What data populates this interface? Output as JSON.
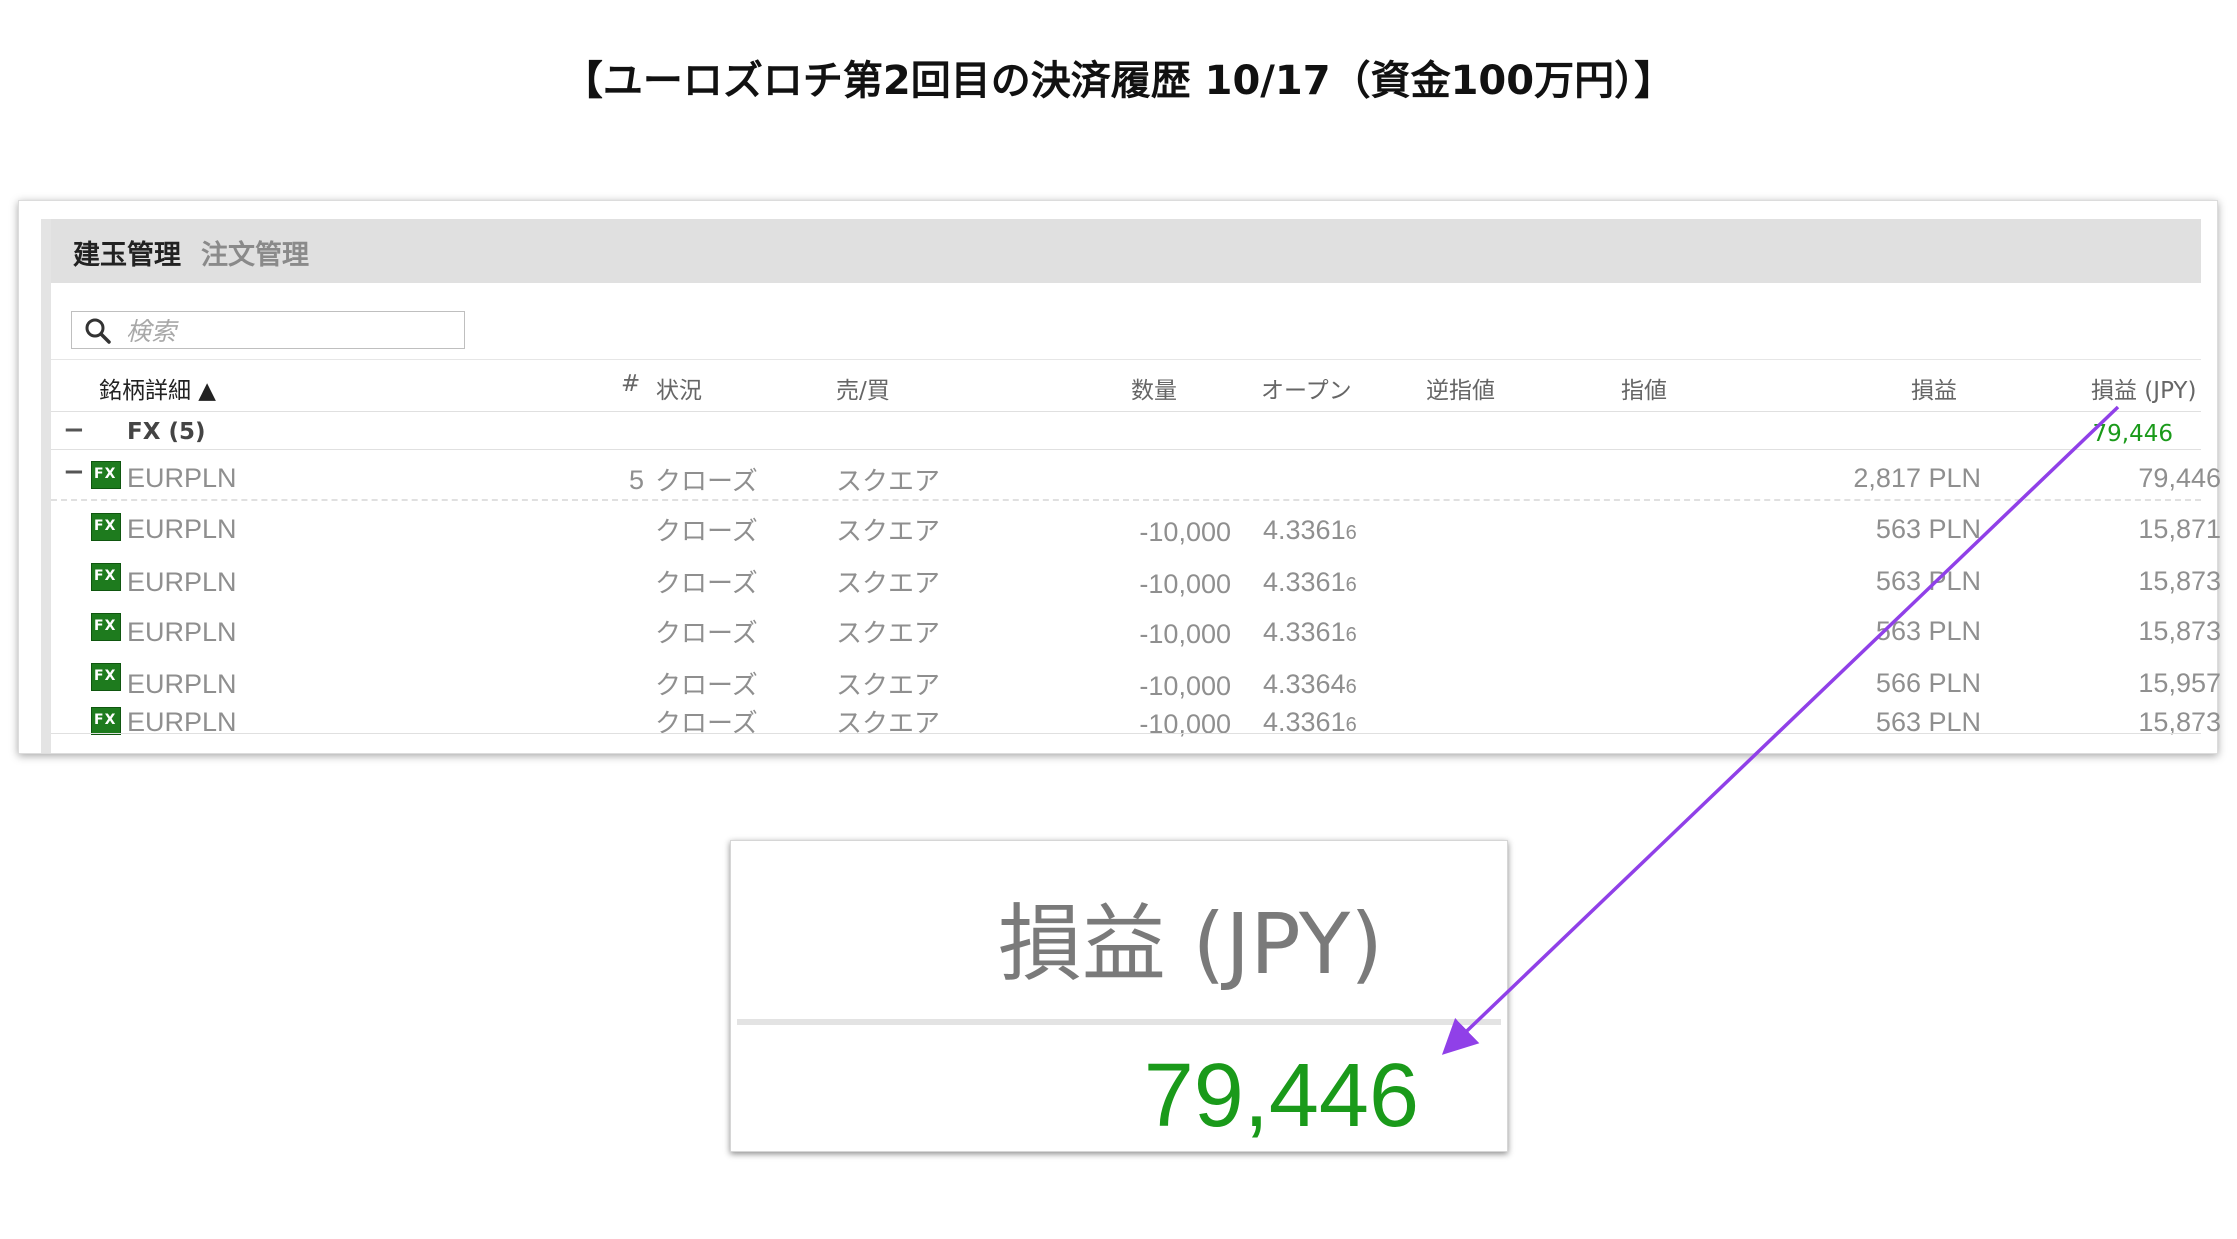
{
  "page_title": "【ユーロズロチ第2回目の決済履歴 10/17（資金100万円）】",
  "tabs": [
    {
      "label": "建玉管理",
      "active": true
    },
    {
      "label": "注文管理",
      "active": false
    }
  ],
  "search": {
    "placeholder": "検索"
  },
  "columns": [
    "銘柄詳細 ▲",
    "#",
    "状況",
    "売/買",
    "数量",
    "オープン",
    "逆指値",
    "指値",
    "損益",
    "損益 (JPY)"
  ],
  "group": {
    "collapse_icon": "−",
    "label": "FX (5)",
    "total_jpy": "79,446"
  },
  "position_summary": {
    "collapse_icon": "−",
    "icon": "FX",
    "symbol": "EURPLN",
    "count": "5",
    "status": "クローズ",
    "side": "スクエア",
    "pl": "2,817 PLN",
    "pl_jpy": "79,446"
  },
  "rows": [
    {
      "icon": "FX",
      "symbol": "EURPLN",
      "status": "クローズ",
      "side": "スクエア",
      "qty": "-10,000",
      "open_main": "4.3361",
      "open_pip": "6",
      "pl": "563 PLN",
      "pl_jpy": "15,871"
    },
    {
      "icon": "FX",
      "symbol": "EURPLN",
      "status": "クローズ",
      "side": "スクエア",
      "qty": "-10,000",
      "open_main": "4.3361",
      "open_pip": "6",
      "pl": "563 PLN",
      "pl_jpy": "15,873"
    },
    {
      "icon": "FX",
      "symbol": "EURPLN",
      "status": "クローズ",
      "side": "スクエア",
      "qty": "-10,000",
      "open_main": "4.3361",
      "open_pip": "6",
      "pl": "563 PLN",
      "pl_jpy": "15,873"
    },
    {
      "icon": "FX",
      "symbol": "EURPLN",
      "status": "クローズ",
      "side": "スクエア",
      "qty": "-10,000",
      "open_main": "4.3364",
      "open_pip": "6",
      "pl": "566 PLN",
      "pl_jpy": "15,957"
    },
    {
      "icon": "FX",
      "symbol": "EURPLN",
      "status": "クローズ",
      "side": "スクエア",
      "qty": "-10,000",
      "open_main": "4.3361",
      "open_pip": "6",
      "pl": "563 PLN",
      "pl_jpy": "15,873"
    }
  ],
  "zoom": {
    "header": "損益 (JPY)",
    "value": "79,446"
  },
  "colors": {
    "profit": "#1a9a1a",
    "arrow": "#9040e8",
    "fx_icon": "#1e7b1e"
  }
}
